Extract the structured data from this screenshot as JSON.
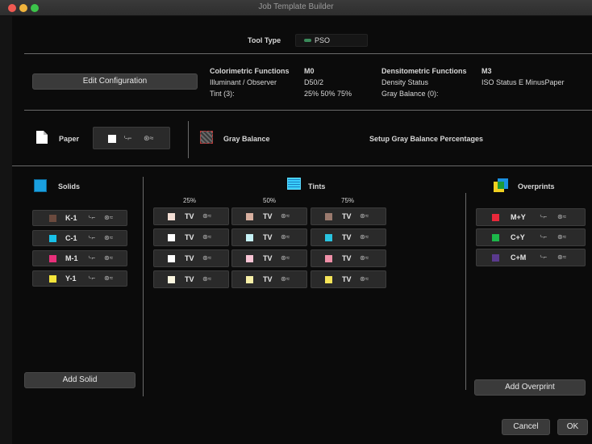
{
  "window": {
    "title": "Job Template Builder"
  },
  "tool_type": {
    "label": "Tool Type",
    "value": "PSO",
    "color": "#3a8a5a"
  },
  "config": {
    "edit_button": "Edit Configuration",
    "colorimetric": {
      "label": "Colorimetric Functions",
      "value": "M0"
    },
    "illuminant": {
      "label": "Illuminant / Observer",
      "value": "D50/2"
    },
    "tint": {
      "label": "Tint (3):",
      "value": "25% 50% 75%"
    },
    "densitometric": {
      "label": "Densitometric Functions",
      "value": "M3"
    },
    "density_status": {
      "label": "Density Status",
      "value": "ISO Status E MinusPaper"
    },
    "gray_balance": {
      "label": "Gray Balance (0):",
      "value": ""
    }
  },
  "paper": {
    "label": "Paper",
    "icon": "page-icon"
  },
  "gray_balance": {
    "label": "Gray Balance",
    "setup": "Setup Gray Balance Percentages"
  },
  "solids": {
    "label": "Solids",
    "color": "#1aa0e0",
    "items": [
      {
        "name": "K-1",
        "color": "#6b4a3e"
      },
      {
        "name": "C-1",
        "color": "#19c1e8"
      },
      {
        "name": "M-1",
        "color": "#e8307a"
      },
      {
        "name": "Y-1",
        "color": "#f5e53a"
      }
    ],
    "add_button": "Add Solid"
  },
  "tints": {
    "label": "Tints",
    "columns": [
      "25%",
      "50%",
      "75%"
    ],
    "tv_label": "TV",
    "rows": [
      [
        "#f2ddd4",
        "#d8b0a0",
        "#9a7a6e"
      ],
      [
        "#ffffff",
        "#c6f2f6",
        "#29c4e0"
      ],
      [
        "#ffffff",
        "#f8c4d4",
        "#f090a8"
      ],
      [
        "#fbf6e0",
        "#f8f0a8",
        "#f6e458"
      ]
    ]
  },
  "overprints": {
    "label": "Overprints",
    "items": [
      {
        "name": "M+Y",
        "color": "#e8283a"
      },
      {
        "name": "C+Y",
        "color": "#1cb84a"
      },
      {
        "name": "C+M",
        "color": "#5a3a8e"
      }
    ],
    "add_button": "Add Overprint"
  },
  "footer": {
    "cancel": "Cancel",
    "ok": "OK"
  }
}
